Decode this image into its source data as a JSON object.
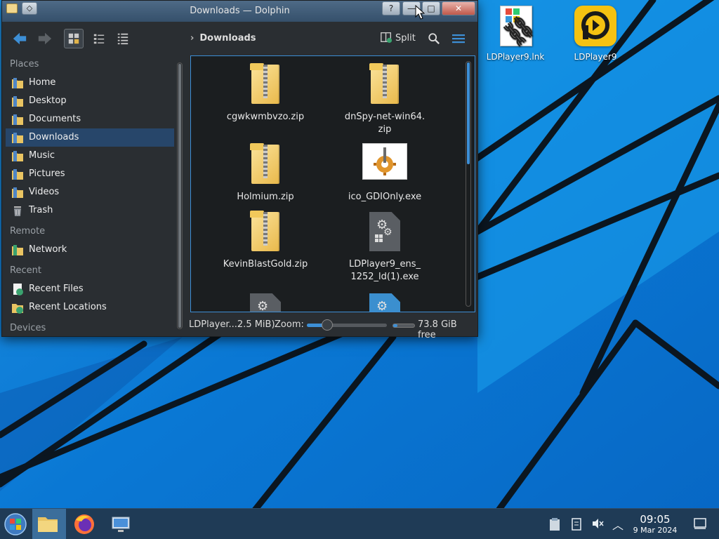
{
  "window": {
    "title": "Downloads — Dolphin",
    "help_label": "?",
    "minimize_label": "—",
    "maximize_label": "□",
    "close_label": "✕"
  },
  "toolbar": {
    "location": "Downloads",
    "split_label": "Split"
  },
  "places": {
    "sections": [
      {
        "header": "Places",
        "items": [
          {
            "label": "Home",
            "icon": "home-folder-icon"
          },
          {
            "label": "Desktop",
            "icon": "desktop-folder-icon"
          },
          {
            "label": "Documents",
            "icon": "documents-folder-icon"
          },
          {
            "label": "Downloads",
            "icon": "downloads-folder-icon",
            "active": true
          },
          {
            "label": "Music",
            "icon": "music-folder-icon"
          },
          {
            "label": "Pictures",
            "icon": "pictures-folder-icon"
          },
          {
            "label": "Videos",
            "icon": "videos-folder-icon"
          },
          {
            "label": "Trash",
            "icon": "trash-icon"
          }
        ]
      },
      {
        "header": "Remote",
        "items": [
          {
            "label": "Network",
            "icon": "network-folder-icon"
          }
        ]
      },
      {
        "header": "Recent",
        "items": [
          {
            "label": "Recent Files",
            "icon": "recent-files-icon"
          },
          {
            "label": "Recent Locations",
            "icon": "recent-locations-icon"
          }
        ]
      },
      {
        "header": "Devices",
        "items": []
      }
    ]
  },
  "files": [
    {
      "name": "cgwkwmbvzo.zip",
      "type": "zip"
    },
    {
      "name": "dnSpy-net-win64.\nzip",
      "type": "zip"
    },
    {
      "name": "Holmium.zip",
      "type": "zip"
    },
    {
      "name": "ico_GDIOnly.exe",
      "type": "gdi-exe"
    },
    {
      "name": "KevinBlastGold.zip",
      "type": "zip"
    },
    {
      "name": "LDPlayer9_ens_\n1252_ld(1).exe",
      "type": "exe"
    },
    {
      "name": "",
      "type": "exe"
    },
    {
      "name": "",
      "type": "exe-blue"
    }
  ],
  "statusbar": {
    "selection": "LDPlayer...2.5 MiB)",
    "zoom_label": "Zoom:",
    "zoom_level": 0.25,
    "free_space_fill": 0.2,
    "free_space": "73.8 GiB free"
  },
  "desktop_icons": [
    {
      "label": "LDPlayer9.lnk",
      "icon": "shortcut-chain-icon"
    },
    {
      "label": "LDPlayer9",
      "icon": "ldplayer-icon"
    }
  ],
  "taskbar": {
    "time": "09:05",
    "date": "9 Mar 2024"
  },
  "colors": {
    "accent": "#3d8fd6",
    "window_bg": "#2a2e32",
    "content_bg": "#1b1e20",
    "selected": "#27466a",
    "taskbar": "#1f3b56",
    "ld_yellow": "#f5c211"
  }
}
